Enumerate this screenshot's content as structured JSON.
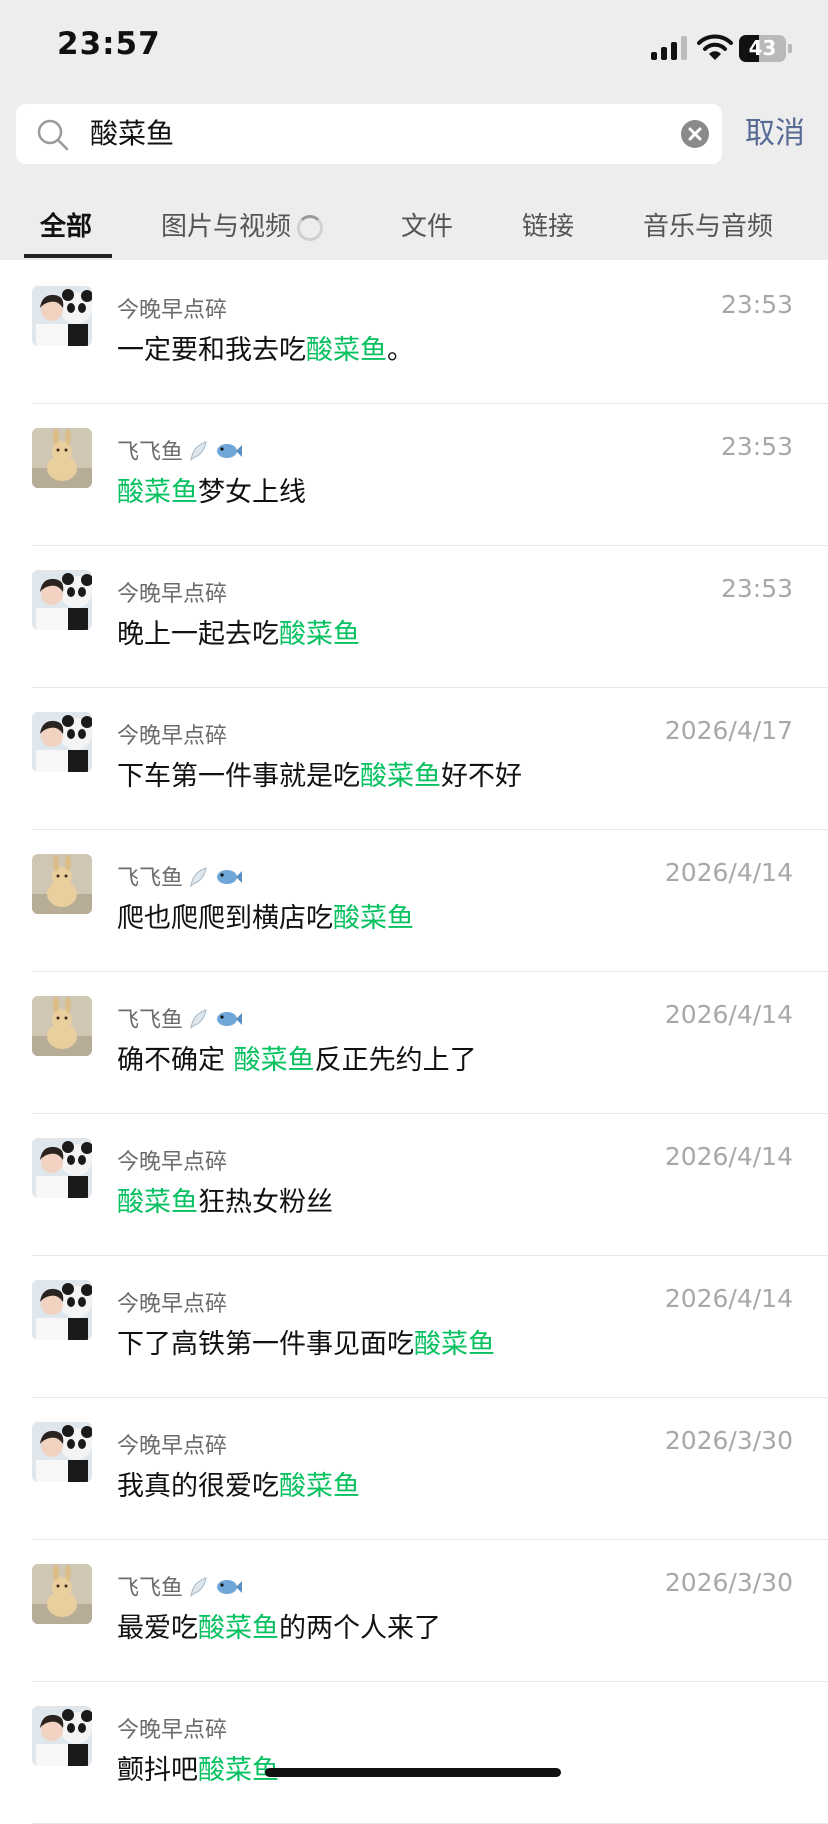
{
  "status_bar": {
    "time": "23:57",
    "battery_percent": 43,
    "battery_label": "43"
  },
  "search": {
    "query": "酸菜鱼",
    "placeholder": "",
    "cancel_label": "取消"
  },
  "tabs": [
    {
      "label": "全部",
      "active": true
    },
    {
      "label": "图片与视频",
      "loading": true
    },
    {
      "label": "文件"
    },
    {
      "label": "链接"
    },
    {
      "label": "音乐与音频"
    }
  ],
  "results": [
    {
      "sender": "今晚早点碎",
      "avatar": "panda-avatar",
      "time": "23:53",
      "pre": "一定要和我去吃",
      "hl": "酸菜鱼",
      "post": "。"
    },
    {
      "sender": "飞飞鱼",
      "sender_icons": [
        "feather-icon",
        "fish-icon"
      ],
      "avatar": "rabbit-avatar",
      "time": "23:53",
      "pre": "",
      "hl": "酸菜鱼",
      "post": "梦女上线"
    },
    {
      "sender": "今晚早点碎",
      "avatar": "panda-avatar",
      "time": "23:53",
      "pre": "晚上一起去吃",
      "hl": "酸菜鱼",
      "post": ""
    },
    {
      "sender": "今晚早点碎",
      "avatar": "panda-avatar",
      "time": "2026/4/17",
      "pre": "下车第一件事就是吃",
      "hl": "酸菜鱼",
      "post": "好不好"
    },
    {
      "sender": "飞飞鱼",
      "sender_icons": [
        "feather-icon",
        "fish-icon"
      ],
      "avatar": "rabbit-avatar",
      "time": "2026/4/14",
      "pre": "爬也爬爬到横店吃",
      "hl": "酸菜鱼",
      "post": ""
    },
    {
      "sender": "飞飞鱼",
      "sender_icons": [
        "feather-icon",
        "fish-icon"
      ],
      "avatar": "rabbit-avatar",
      "time": "2026/4/14",
      "pre": "确不确定 ",
      "hl": "酸菜鱼",
      "post": "反正先约上了"
    },
    {
      "sender": "今晚早点碎",
      "avatar": "panda-avatar",
      "time": "2026/4/14",
      "pre": "",
      "hl": "酸菜鱼",
      "post": "狂热女粉丝"
    },
    {
      "sender": "今晚早点碎",
      "avatar": "panda-avatar",
      "time": "2026/4/14",
      "pre": "下了高铁第一件事见面吃",
      "hl": "酸菜鱼",
      "post": ""
    },
    {
      "sender": "今晚早点碎",
      "avatar": "panda-avatar",
      "time": "2026/3/30",
      "pre": "我真的很爱吃",
      "hl": "酸菜鱼",
      "post": ""
    },
    {
      "sender": "飞飞鱼",
      "sender_icons": [
        "feather-icon",
        "fish-icon"
      ],
      "avatar": "rabbit-avatar",
      "time": "2026/3/30",
      "pre": "最爱吃",
      "hl": "酸菜鱼",
      "post": "的两个人来了"
    },
    {
      "sender": "今晚早点碎",
      "avatar": "panda-avatar",
      "time": "",
      "pre": "颤抖吧",
      "hl": "酸菜鱼",
      "post": ""
    }
  ],
  "colors": {
    "highlight": "#07c160",
    "cancel": "#576b95",
    "header_bg": "#ededed"
  }
}
